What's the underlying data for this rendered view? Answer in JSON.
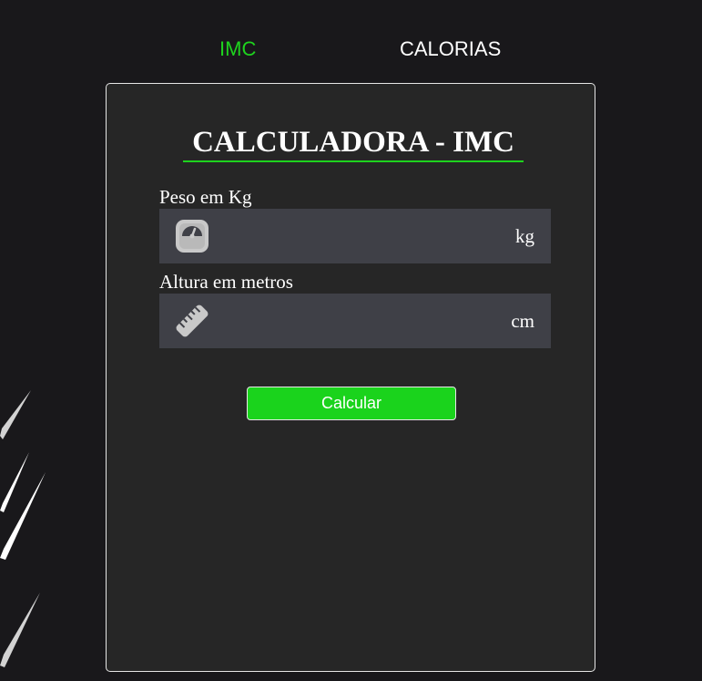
{
  "nav": {
    "tabs": [
      {
        "label": "IMC",
        "active": true
      },
      {
        "label": "CALORIAS",
        "active": false
      }
    ]
  },
  "card": {
    "title": "CALCULADORA - IMC",
    "fields": [
      {
        "label": "Peso em Kg",
        "value": "",
        "unit": "kg",
        "icon": "scale-icon"
      },
      {
        "label": "Altura em metros",
        "value": "",
        "unit": "cm",
        "icon": "ruler-icon"
      }
    ],
    "button_label": "Calcular"
  },
  "colors": {
    "background": "#19181b",
    "card": "#262626",
    "field": "#3f4047",
    "accent": "#1ed31e",
    "button": "#1ad31c"
  }
}
